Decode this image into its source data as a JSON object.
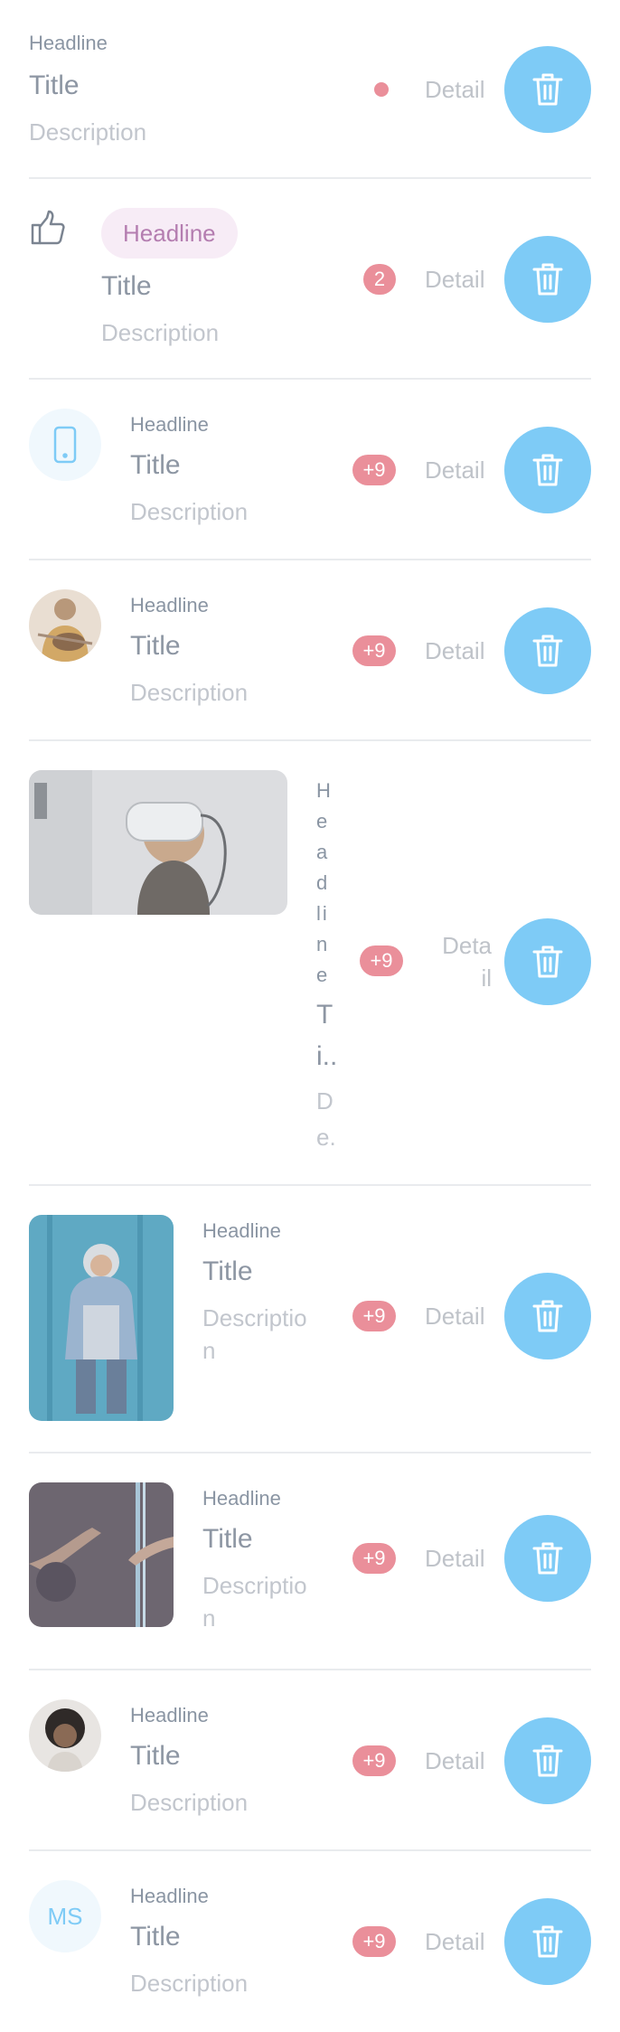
{
  "colors": {
    "accent": "#7ecbf6",
    "badge": "#ea8f9a",
    "divider": "#e9ebee",
    "chip_bg": "#f7ecf6",
    "chip_text": "#b47db0"
  },
  "rows": [
    {
      "headline": "Headline",
      "title": "Title",
      "description": "Description",
      "detail": "Detail",
      "indicator": "dot",
      "action_icon": "trash-icon"
    },
    {
      "leading_icon": "thumbs-up-icon",
      "headline": "Headline",
      "title": "Title",
      "description": "Description",
      "badge": "2",
      "detail": "Detail",
      "action_icon": "trash-icon"
    },
    {
      "leading_icon": "smartphone-icon",
      "headline": "Headline",
      "title": "Title",
      "description": "Description",
      "badge": "+9",
      "detail": "Detail",
      "action_icon": "trash-icon"
    },
    {
      "leading_image": "avatar-guitar-player",
      "headline": "Headline",
      "title": "Title",
      "description": "Description",
      "badge": "+9",
      "detail": "Detail",
      "action_icon": "trash-icon"
    },
    {
      "leading_image": "vr-headset-photo",
      "headline": "Headline",
      "title": "T i..",
      "description": "D e.",
      "badge": "+9",
      "detail": "Deta il",
      "action_icon": "trash-icon"
    },
    {
      "leading_image": "hoodie-person-photo",
      "headline": "Headline",
      "title": "Title",
      "description": "Descriptio n",
      "badge": "+9",
      "detail": "Detail",
      "action_icon": "trash-icon"
    },
    {
      "leading_image": "hands-concert-photo",
      "headline": "Headline",
      "title": "Title",
      "description": "Descriptio n",
      "badge": "+9",
      "detail": "Detail",
      "action_icon": "trash-icon"
    },
    {
      "leading_image": "avatar-curly-hair",
      "headline": "Headline",
      "title": "Title",
      "description": "Description",
      "badge": "+9",
      "detail": "Detail",
      "action_icon": "trash-icon"
    },
    {
      "leading_initials": "MS",
      "headline": "Headline",
      "title": "Title",
      "description": "Description",
      "badge": "+9",
      "detail": "Detail",
      "action_icon": "trash-icon"
    }
  ]
}
